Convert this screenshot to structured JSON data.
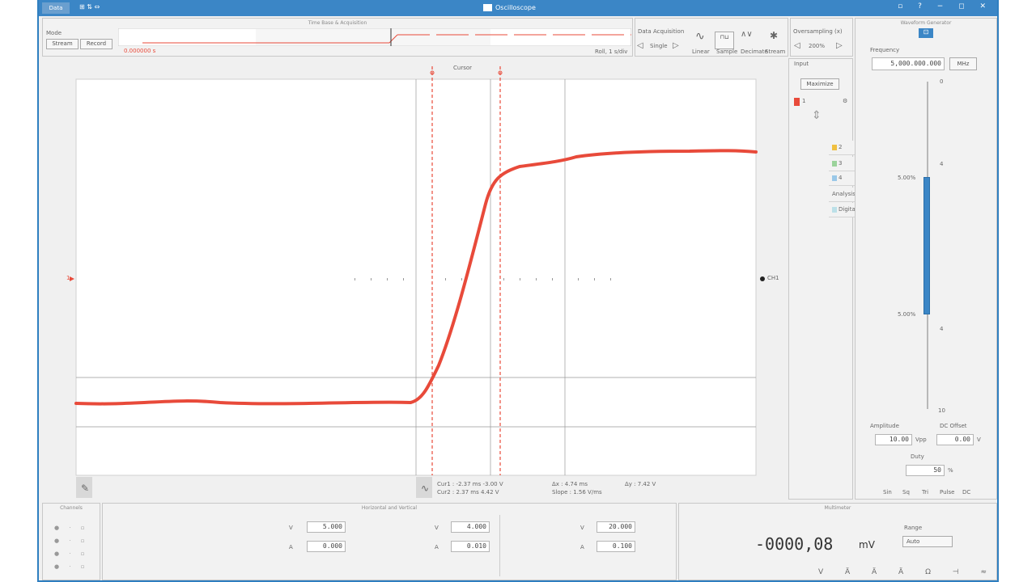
{
  "app": {
    "menu_label": "Data",
    "title": "Oscilloscope"
  },
  "timebase": {
    "mode_label": "Mode",
    "modes": [
      "Stream",
      "Record"
    ],
    "header": "Time Base & Acquisition",
    "legend": "0.000000 s",
    "right_label": "Roll, 1 s/div"
  },
  "acquisition": {
    "label": "Data Acquisition",
    "mode_value": "Single",
    "buttons": [
      "Linear",
      "Sample",
      "Decimate",
      "Stream"
    ]
  },
  "oversample": {
    "label": "Oversampling (x)",
    "value": "200%"
  },
  "plot": {
    "cursor_label": "Cursor",
    "colors": {
      "trace": "#e84a3a",
      "cursor": "#e84a3a",
      "grid": "#999999"
    },
    "cursor_readout": [
      "Cur1 : -2.37 ms  -3.00 V",
      "Cur2 : 2.37 ms  4.42 V",
      "Δx : 4.74 ms",
      "Slope : 1.56 V/ms",
      "Δy : 7.42 V"
    ],
    "right_marker": "CH1",
    "left_marker": "1"
  },
  "channels_panel": {
    "header": "Input",
    "maximize": "Maximize",
    "items": [
      {
        "label": "2",
        "color": "#f0c040"
      },
      {
        "label": "3",
        "color": "#9bd39b"
      },
      {
        "label": "4",
        "color": "#9ac8e8"
      },
      {
        "label": "Analysis"
      },
      {
        "label": "Digital",
        "color": "#bce0e8"
      }
    ]
  },
  "generator": {
    "header": "Waveform Generator",
    "frequency_label": "Frequency",
    "frequency_value": "5,000.000.000",
    "frequency_unit": "MHz",
    "slider_labels_top": [
      "0",
      "4"
    ],
    "slider_labels_bottom": [
      "4",
      "10"
    ],
    "mid_labels": [
      "5.00%",
      "5.00%"
    ],
    "amplitude_label": "Amplitude",
    "offset_label": "DC Offset",
    "amplitude_value": "10.00",
    "amplitude_unit": "Vpp",
    "offset_value": "0.00",
    "offset_unit": "V",
    "duty_label": "Duty",
    "duty_value": "50",
    "duty_unit": "%",
    "shapes": [
      "Sin",
      "Sq",
      "Tri",
      "Pulse",
      "DC"
    ]
  },
  "bottom": {
    "channels_header": "Channels",
    "measure_header": "Horizontal and Vertical",
    "meas_rows": [
      {
        "label": "V",
        "value": "5.000"
      },
      {
        "label": "A",
        "value": "0.000"
      }
    ],
    "col2": [
      {
        "label": "V",
        "value": "4.000"
      },
      {
        "label": "A",
        "value": "0.010"
      }
    ],
    "col3": [
      {
        "label": "V",
        "value": "20.000"
      },
      {
        "label": "A",
        "value": "0.100"
      }
    ],
    "dmm_header": "Multimeter",
    "dmm_reading": "-0000,08",
    "dmm_unit": "mV",
    "dmm_mode": "Auto",
    "dmm_range_label": "Range"
  }
}
